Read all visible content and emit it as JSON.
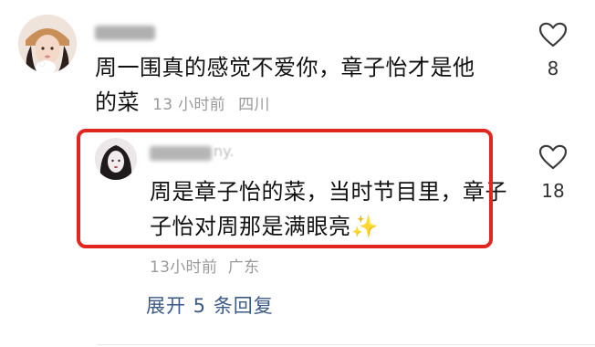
{
  "main_comment": {
    "text_line1": "周一围真的感觉不爱你，章子怡才是他",
    "text_line2": "的菜",
    "time": "13 小时前",
    "location": "四川",
    "like_count": "8"
  },
  "reply": {
    "username_visible": "ny.",
    "text_line1": "周是章子怡的菜，当时节目里，章子",
    "text_line2": "子怡对周那是满眼亮",
    "emoji": "✨",
    "time": "13小时前",
    "location": "广东",
    "like_count": "18"
  },
  "expand_replies": "展开 5 条回复",
  "colors": {
    "highlight": "#e2251f",
    "link": "#3b5a85",
    "meta": "#9a9a9a"
  }
}
